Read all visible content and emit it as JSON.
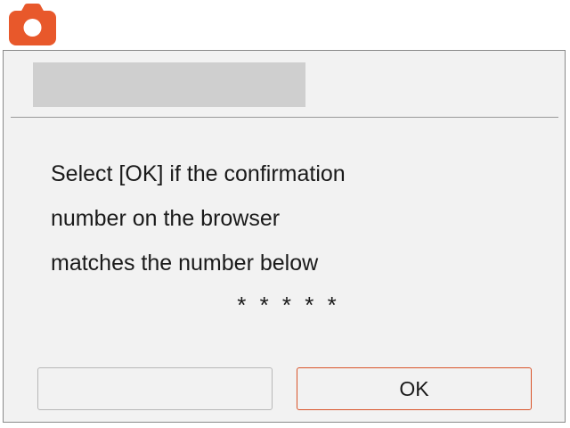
{
  "app": {
    "icon": "camera-icon",
    "accent_color": "#e8582b"
  },
  "dialog": {
    "title": "",
    "message_lines": [
      "Select [OK] if the confirmation",
      "number on the browser",
      "matches the number below"
    ],
    "confirmation_number": "* * * * *",
    "buttons": {
      "left_label": "",
      "ok_label": "OK",
      "ok_border_color": "#d9542a"
    }
  }
}
